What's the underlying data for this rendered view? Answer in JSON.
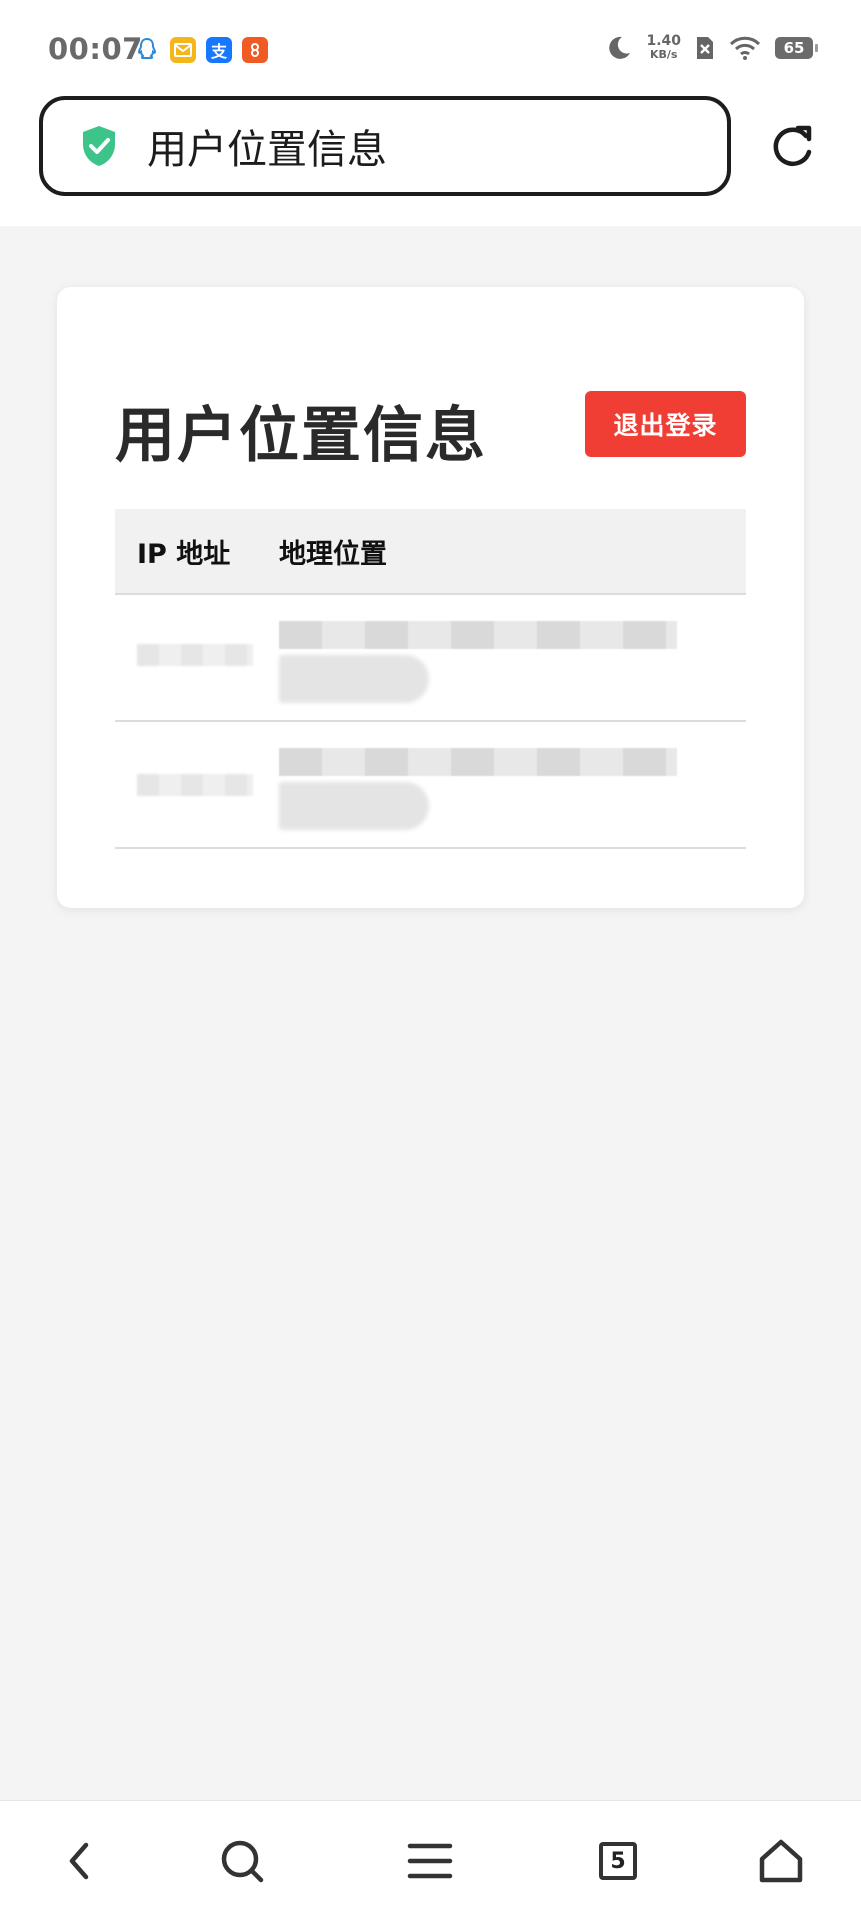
{
  "status_bar": {
    "time": "00:07",
    "notifications": [
      "qq-icon",
      "mail-icon",
      "alipay-icon",
      "taobao-icon"
    ],
    "alipay_glyph": "支",
    "net_speed_value": "1.40",
    "net_speed_unit": "KB/s",
    "battery_level": "65"
  },
  "address_bar": {
    "title": "用户位置信息",
    "secure_color": "#3cc48a"
  },
  "card": {
    "title": "用户位置信息",
    "logout_label": "退出登录",
    "logout_color": "#f03e35",
    "table": {
      "headers": [
        "IP 地址",
        "地理位置"
      ]
    }
  },
  "bottom_nav": {
    "items": [
      "back-icon",
      "search-icon",
      "menu-icon",
      "tabs-icon",
      "home-icon"
    ],
    "tabs_count": "5"
  }
}
